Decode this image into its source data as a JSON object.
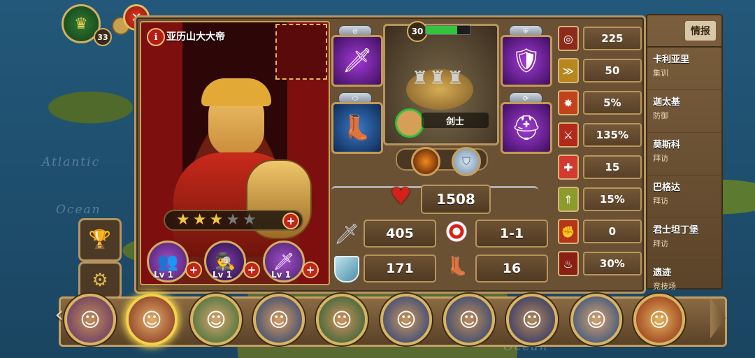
{
  "map": {
    "labels": [
      "Atlantic",
      "Ocean",
      "Ocean"
    ]
  },
  "player": {
    "level": "33"
  },
  "hero": {
    "name": "亚历山大大帝",
    "info_icon": "i",
    "stars_filled": 3,
    "stars_total": 5,
    "skills": [
      {
        "icon": "soldiers-icon",
        "level": "Lv 1"
      },
      {
        "icon": "spy-icon",
        "level": "Lv 1"
      },
      {
        "icon": "sword-icon",
        "level": "Lv 1"
      }
    ]
  },
  "unit": {
    "level": "30",
    "type": "剑士"
  },
  "stats": {
    "hp": "1508",
    "attack": "405",
    "range": "1-1",
    "defense": "171",
    "move": "16"
  },
  "attributes": [
    {
      "icon": "target-icon",
      "value": "225"
    },
    {
      "icon": "speed-icon",
      "value": "50"
    },
    {
      "icon": "burst-icon",
      "value": "5%"
    },
    {
      "icon": "sword-up-icon",
      "value": "135%"
    },
    {
      "icon": "heal-icon",
      "value": "15"
    },
    {
      "icon": "rank-up-icon",
      "value": "15%"
    },
    {
      "icon": "fist-icon",
      "value": "0"
    },
    {
      "icon": "fire-warrior-icon",
      "value": "30%"
    }
  ],
  "intel": {
    "title": "情报",
    "cities": [
      {
        "name": "卡利亚里",
        "status": "集训"
      },
      {
        "name": "迦太基",
        "status": "防御"
      },
      {
        "name": "莫斯科",
        "status": "拜访"
      },
      {
        "name": "巴格达",
        "status": "拜访"
      },
      {
        "name": "君士坦丁堡",
        "status": "拜访"
      },
      {
        "name": "遗迹",
        "status": "竞技场"
      }
    ]
  },
  "roster": {
    "count": 10,
    "selected_index": 1
  },
  "colors": {
    "frame": "#6a5134",
    "gold": "#b69561",
    "hp_red": "#d4211b",
    "selection": "#f2d24b"
  }
}
